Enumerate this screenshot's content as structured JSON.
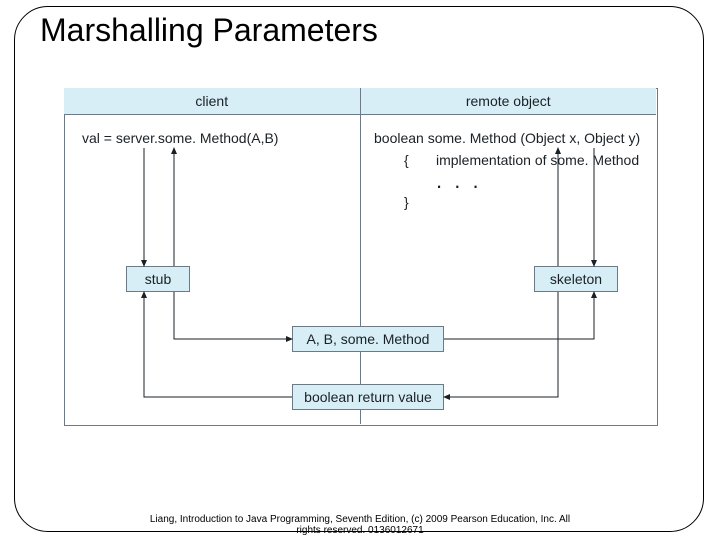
{
  "title": "Marshalling Parameters",
  "header": {
    "left": "client",
    "right": "remote object"
  },
  "client_expr": "val = server.some. Method(A,B)",
  "remote_sig": "boolean some. Method (Object x, Object y)",
  "brace_open": "{",
  "impl_label": "implementation of some. Method",
  "dots": ". . .",
  "brace_close": "}",
  "stub": "stub",
  "skeleton": "skeleton",
  "args_box": "A, B, some. Method",
  "return_box": "boolean return value",
  "footer_line1": "Liang, Introduction to Java Programming, Seventh Edition, (c) 2009 Pearson Education, Inc. All",
  "footer_line2": "rights reserved. 0136012671"
}
